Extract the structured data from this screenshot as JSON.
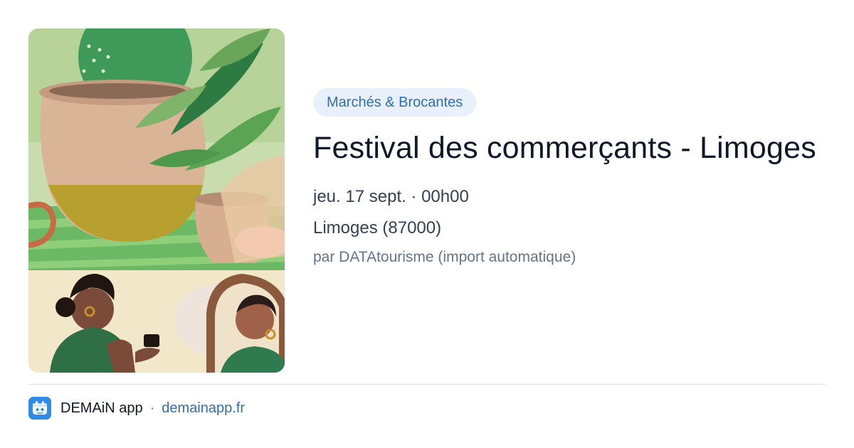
{
  "event": {
    "category": "Marchés & Brocantes",
    "title": "Festival des commerçants - Limoges",
    "date": "jeu. 17 sept. · 00h00",
    "place": "Limoges (87000)",
    "source": "par DATAtourisme (import automatique)"
  },
  "footer": {
    "app_name": "DEMAiN app",
    "separator": "·",
    "domain": "demainapp.fr"
  },
  "colors": {
    "accent": "#2f6fb8",
    "pill_bg": "#e8f1fb",
    "logo_bg": "#2f8be8"
  }
}
